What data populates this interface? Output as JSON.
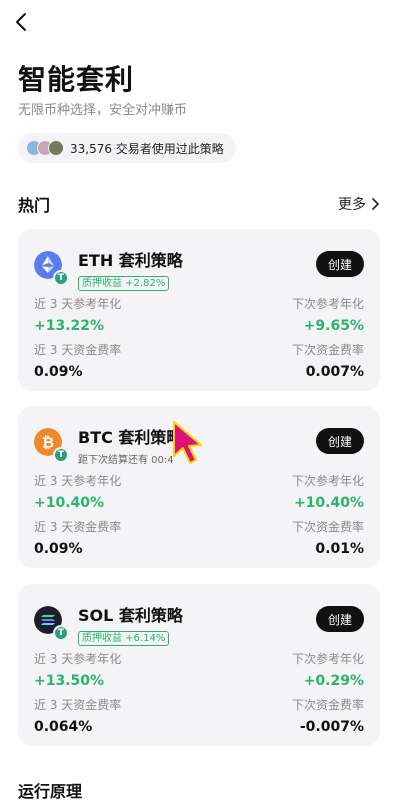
{
  "header": {
    "title": "智能套利",
    "subtitle": "无限币种选择，安全对冲赚币",
    "traders_text": "33,576 交易者使用过此策略"
  },
  "section": {
    "title": "热门",
    "more_label": "更多"
  },
  "cards": [
    {
      "name": "ETH 套利策略",
      "tag": "质押收益 +2.82%",
      "button": "创建",
      "left_top_label": "近 3 天参考年化",
      "left_top_value": "+13.22%",
      "right_top_label": "下次参考年化",
      "right_top_value": "+9.65%",
      "left_bottom_label": "近 3 天资金费率",
      "left_bottom_value": "0.09%",
      "right_bottom_label": "下次资金费率",
      "right_bottom_value": "0.007%"
    },
    {
      "name": "BTC 套利策略",
      "tag": "距下次结算还有 00:4",
      "button": "创建",
      "left_top_label": "近 3 天参考年化",
      "left_top_value": "+10.40%",
      "right_top_label": "下次参考年化",
      "right_top_value": "+10.40%",
      "left_bottom_label": "近 3 天资金费率",
      "left_bottom_value": "0.09%",
      "right_bottom_label": "下次资金费率",
      "right_bottom_value": "0.01%"
    },
    {
      "name": "SOL 套利策略",
      "tag": "质押收益 +6.14%",
      "button": "创建",
      "left_top_label": "近 3 天参考年化",
      "left_top_value": "+13.50%",
      "right_top_label": "下次参考年化",
      "right_top_value": "+0.29%",
      "left_bottom_label": "近 3 天资金费率",
      "left_bottom_value": "0.064%",
      "right_bottom_label": "下次资金费率",
      "right_bottom_value": "-0.007%"
    }
  ],
  "bottom": {
    "title": "运行原理"
  },
  "colors": {
    "positive": "#2ab56b",
    "eth": "#5b7cf0",
    "btc": "#f0882c",
    "sol": "#1d1d2b",
    "tether": "#26a17b",
    "cursor": "#e0107a"
  },
  "icons": {
    "back": "chevron-left-icon",
    "more": "chevron-right-icon",
    "cursor": "mouse-pointer-icon"
  }
}
